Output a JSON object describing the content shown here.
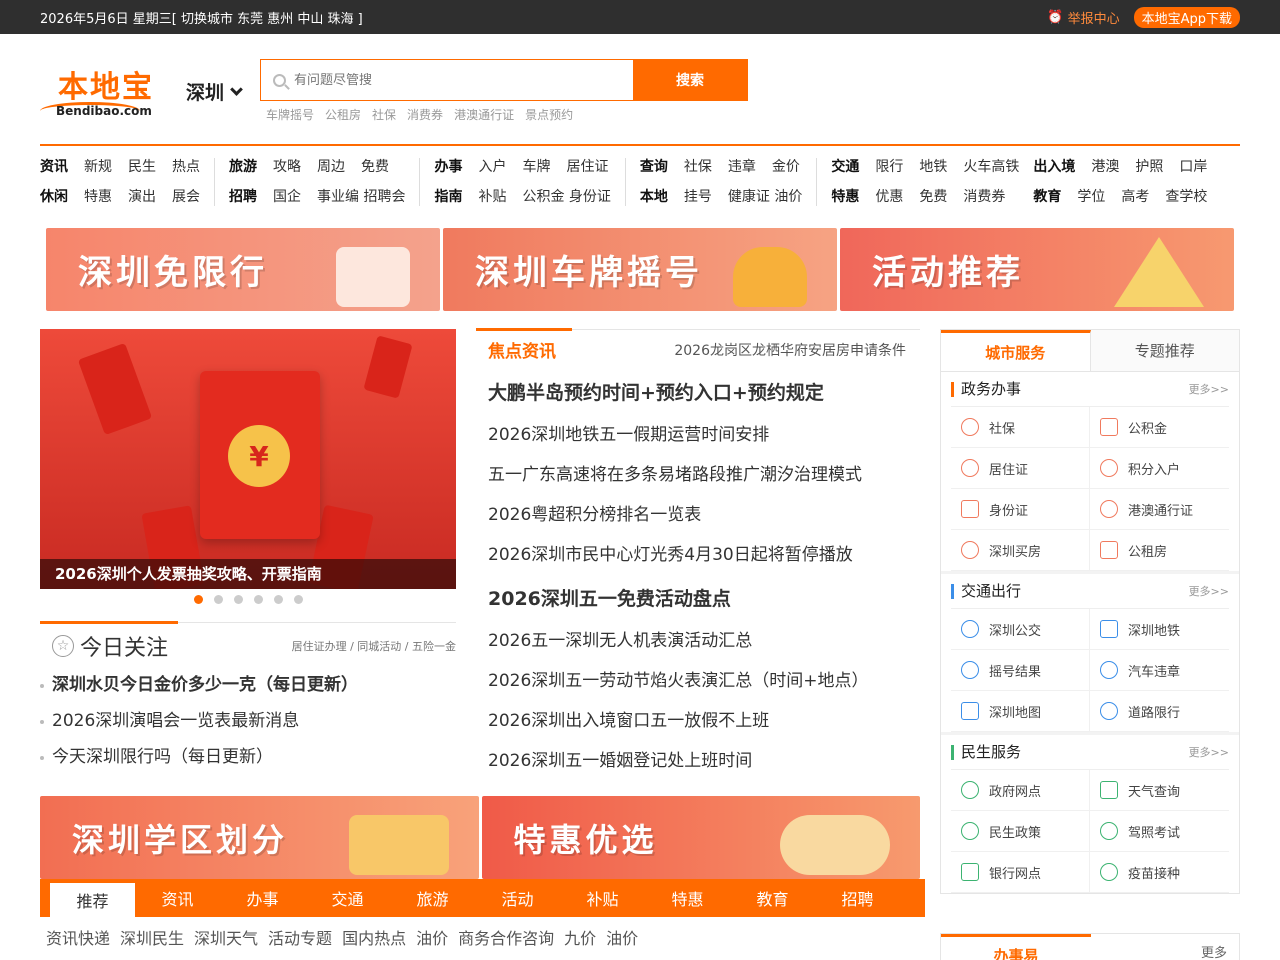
{
  "topbar": {
    "date_text": "2026年5月6日 星期三[ 切换城市 东莞 惠州 中山 珠海 ]",
    "report": "举报中心",
    "app_download": "本地宝App下载"
  },
  "header": {
    "logo_cn": "本地宝",
    "logo_en": "Bendibao.com",
    "city": "深圳",
    "search_placeholder": "有问题尽管搜",
    "search_button": "搜索",
    "hotwords": [
      "车牌摇号",
      "公租房",
      "社保",
      "消费券",
      "港澳通行证",
      "景点预约"
    ]
  },
  "nav": [
    {
      "rows": [
        [
          "资讯",
          "新规",
          "民生",
          "热点"
        ],
        [
          "休闲",
          "特惠",
          "演出",
          "展会"
        ]
      ]
    },
    {
      "rows": [
        [
          "旅游",
          "攻略",
          "周边",
          "免费"
        ],
        [
          "招聘",
          "国企",
          "事业编 招聘会"
        ]
      ]
    },
    {
      "rows": [
        [
          "办事",
          "入户",
          "车牌",
          "居住证"
        ],
        [
          "指南",
          "补贴",
          "公积金 身份证"
        ]
      ]
    },
    {
      "rows": [
        [
          "查询",
          "社保",
          "违章",
          "金价"
        ],
        [
          "本地",
          "挂号",
          "健康证 油价"
        ]
      ]
    },
    {
      "rows": [
        [
          "交通",
          "限行",
          "地铁",
          "火车高铁"
        ],
        [
          "特惠",
          "优惠",
          "免费",
          "消费券"
        ]
      ]
    },
    {
      "rows": [
        [
          "出入境",
          "港澳",
          "护照",
          "口岸"
        ],
        [
          "教育",
          "学位",
          "高考",
          "查学校"
        ]
      ]
    }
  ],
  "banners": [
    "深圳免限行",
    "深圳车牌摇号",
    "活动推荐"
  ],
  "slider": {
    "caption": "2026深圳个人发票抽奖攻略、开票指南",
    "coin": "¥",
    "dot_count": 6,
    "active_dot": 0
  },
  "focus": {
    "title": "今日关注",
    "links": "居住证办理 / 同城活动 / 五险一金",
    "items": [
      {
        "text": "深圳水贝今日金价多少一克（每日更新）",
        "bold": true
      },
      {
        "text": "2026深圳演唱会一览表最新消息",
        "bold": false
      },
      {
        "text": "今天深圳限行吗（每日更新）",
        "bold": false
      }
    ]
  },
  "news": {
    "label": "焦点资讯",
    "sub": "2026龙岗区龙栖华府安居房申请条件",
    "items": [
      {
        "text": "大鹏半岛预约时间+预约入口+预约规定",
        "bold": true
      },
      {
        "text": "2026深圳地铁五一假期运营时间安排",
        "bold": false
      },
      {
        "text": "五一广东高速将在多条易堵路段推广潮汐治理模式",
        "bold": false
      },
      {
        "text": "2026粤超积分榜排名一览表",
        "bold": false
      },
      {
        "text": "2026深圳市民中心灯光秀4月30日起将暂停播放",
        "bold": false
      },
      {
        "text": "2026深圳五一免费活动盘点",
        "bold": true
      },
      {
        "text": "2026五一深圳无人机表演活动汇总",
        "bold": false
      },
      {
        "text": "2026深圳五一劳动节焰火表演汇总（时间+地点）",
        "bold": false
      },
      {
        "text": "2026深圳出入境窗口五一放假不上班",
        "bold": false
      },
      {
        "text": "2026深圳五一婚姻登记处上班时间",
        "bold": false
      }
    ]
  },
  "services": {
    "tab_active": "城市服务",
    "tab_other": "专题推荐",
    "more": "更多>>",
    "sections": [
      {
        "title": "政务办事",
        "color": "orange",
        "items": [
          "社保",
          "公积金",
          "居住证",
          "积分入户",
          "身份证",
          "港澳通行证",
          "深圳买房",
          "公租房"
        ]
      },
      {
        "title": "交通出行",
        "color": "blue",
        "items": [
          "深圳公交",
          "深圳地铁",
          "摇号结果",
          "汽车违章",
          "深圳地图",
          "道路限行"
        ]
      },
      {
        "title": "民生服务",
        "color": "green",
        "items": [
          "政府网点",
          "天气查询",
          "民生政策",
          "驾照考试",
          "银行网点",
          "疫苗接种"
        ]
      }
    ]
  },
  "bottom_banners": [
    "深圳学区划分",
    "特惠优选"
  ],
  "categories": [
    "推荐",
    "资讯",
    "办事",
    "交通",
    "旅游",
    "活动",
    "补贴",
    "特惠",
    "教育",
    "招聘"
  ],
  "sublinks": [
    "资讯快递",
    "深圳民生",
    "深圳天气",
    "活动专题",
    "国内热点",
    "油价",
    "商务合作咨询",
    "九价",
    "油价"
  ],
  "bottom_right": {
    "tab": "办事易",
    "more": "更多"
  }
}
